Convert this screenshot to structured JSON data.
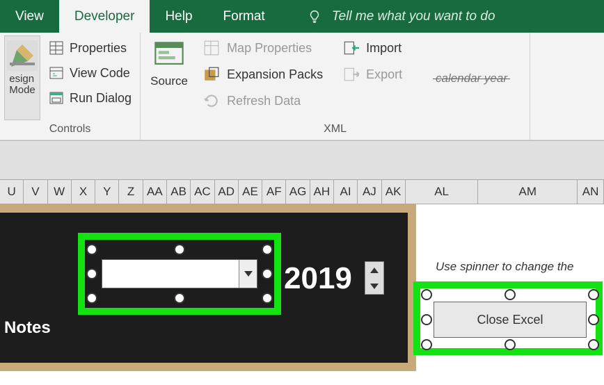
{
  "tabs": {
    "view": "View",
    "developer": "Developer",
    "help": "Help",
    "format": "Format",
    "tellme": "Tell me what you want to do"
  },
  "controls_group": {
    "label": "Controls",
    "design_mode_l1": "esign",
    "design_mode_l2": "Mode",
    "properties": "Properties",
    "view_code": "View Code",
    "run_dialog": "Run Dialog"
  },
  "xml_group": {
    "label": "XML",
    "source": "Source",
    "map_properties": "Map Properties",
    "expansion_packs": "Expansion Packs",
    "refresh_data": "Refresh Data",
    "import": "Import",
    "export": "Export"
  },
  "columns": [
    "U",
    "V",
    "W",
    "X",
    "Y",
    "Z",
    "AA",
    "AB",
    "AC",
    "AD",
    "AE",
    "AF",
    "AG",
    "AH",
    "AI",
    "AJ",
    "AK",
    "AL",
    "AM",
    "AN"
  ],
  "sheet": {
    "year": "2019",
    "notes": "Notes",
    "hint_line1": "Use spinner to change the",
    "hint_line2": "calendar year",
    "close_button": "Close Excel"
  }
}
